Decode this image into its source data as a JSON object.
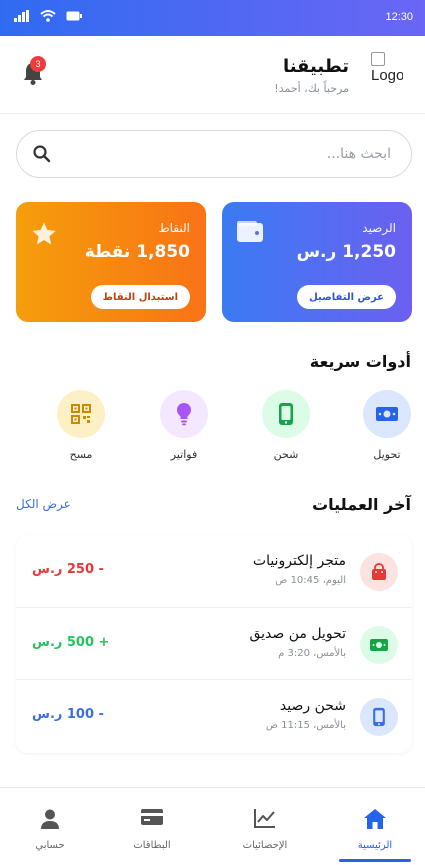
{
  "status_bar": {
    "time": "12:30"
  },
  "header": {
    "logo_alt": "Logo",
    "title": "تطبيقنا",
    "subtitle": "مرحباً بك، أحمد!",
    "notification_count": "3"
  },
  "search": {
    "placeholder": "ابحث هنا..."
  },
  "cards": {
    "balance": {
      "label": "الرصيد",
      "value": "1,250 ر.س",
      "button": "عرض التفاصيل"
    },
    "points": {
      "label": "النقاط",
      "value": "1,850 نقطة",
      "button": "استبدال النقاط"
    }
  },
  "quick_tools": {
    "title": "أدوات سريعة",
    "items": [
      {
        "label": "تحويل",
        "icon": "money-transfer-icon"
      },
      {
        "label": "شحن",
        "icon": "mobile-phone-icon"
      },
      {
        "label": "فواتير",
        "icon": "lightbulb-icon"
      },
      {
        "label": "مسح",
        "icon": "qr-code-icon"
      }
    ]
  },
  "transactions": {
    "title": "آخر العمليات",
    "view_all": "عرض الكل",
    "items": [
      {
        "name": "متجر إلكترونيات",
        "date": "اليوم، 10:45 ص",
        "amount": "- 250 ر.س",
        "icon": "shopping-bag-icon"
      },
      {
        "name": "تحويل من صديق",
        "date": "بالأمس، 3:20 م",
        "amount": "+ 500 ر.س",
        "icon": "cash-icon"
      },
      {
        "name": "شحن رصيد",
        "date": "بالأمس، 11:15 ص",
        "amount": "- 100 ر.س",
        "icon": "mobile-phone-icon"
      }
    ]
  },
  "bottom_nav": {
    "items": [
      {
        "label": "الرئيسية",
        "icon": "home-icon",
        "active": true
      },
      {
        "label": "الإحصائيات",
        "icon": "chart-line-icon",
        "active": false
      },
      {
        "label": "البطاقات",
        "icon": "credit-card-icon",
        "active": false
      },
      {
        "label": "حسابي",
        "icon": "user-icon",
        "active": false
      }
    ]
  },
  "colors": {
    "primary": "#2563eb",
    "negative": "#e53935",
    "positive": "#22c55e",
    "recharge": "#3b6fe0"
  }
}
